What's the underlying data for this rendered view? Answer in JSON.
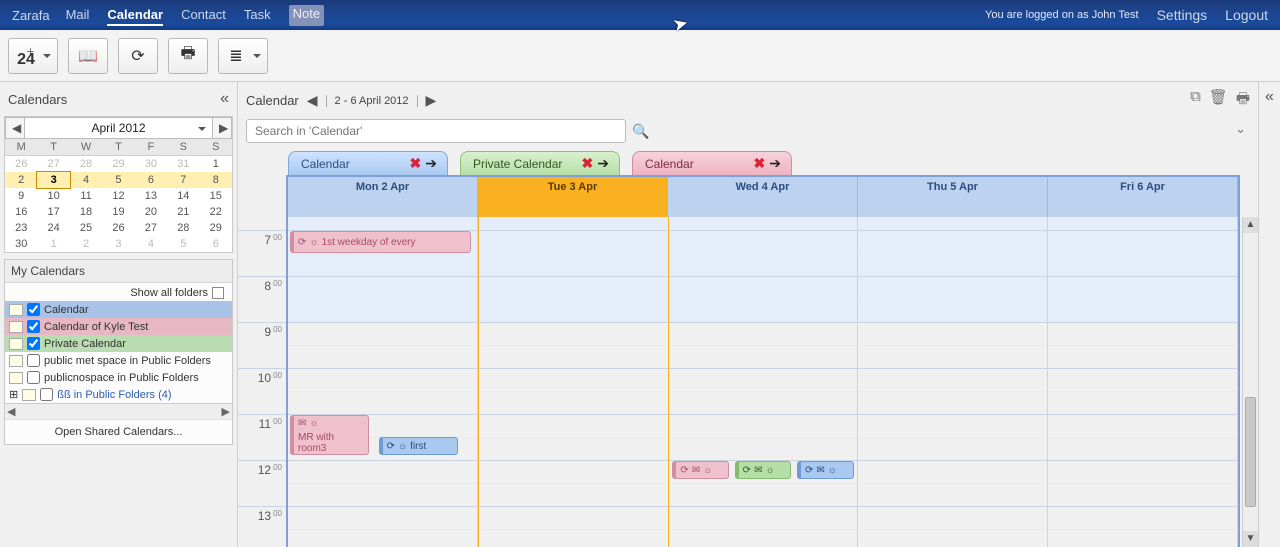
{
  "brand": "Zarafa",
  "nav": {
    "mail": "Mail",
    "calendar": "Calendar",
    "contact": "Contact",
    "task": "Task",
    "note": "Note"
  },
  "logged_on_prefix": "You are logged on as ",
  "logged_on_user": "John Test",
  "settings": "Settings",
  "logout": "Logout",
  "toolbar": {
    "new_day": "24",
    "addressbook": "📖",
    "refresh": "⟳",
    "print": "🖶",
    "view": "≣"
  },
  "side": {
    "calendars_label": "Calendars",
    "month_title": "April 2012",
    "dow": [
      "M",
      "T",
      "W",
      "T",
      "F",
      "S",
      "S"
    ],
    "weeks": [
      [
        "26",
        "27",
        "28",
        "29",
        "30",
        "31",
        "1"
      ],
      [
        "2",
        "3",
        "4",
        "5",
        "6",
        "7",
        "8"
      ],
      [
        "9",
        "10",
        "11",
        "12",
        "13",
        "14",
        "15"
      ],
      [
        "16",
        "17",
        "18",
        "19",
        "20",
        "21",
        "22"
      ],
      [
        "23",
        "24",
        "25",
        "26",
        "27",
        "28",
        "29"
      ],
      [
        "30",
        "1",
        "2",
        "3",
        "4",
        "5",
        "6"
      ]
    ],
    "my_calendars": "My Calendars",
    "show_all": "Show all folders",
    "items": [
      "Calendar",
      "Calendar of Kyle Test",
      "Private Calendar",
      "public met space in Public Folders",
      "publicnospace in Public Folders",
      "ßß in Public Folders  (4)"
    ],
    "open_shared": "Open Shared Calendars..."
  },
  "main": {
    "title": "Calendar",
    "range": "2 - 6 April 2012",
    "search_placeholder": "Search in 'Calendar'",
    "tabs": [
      "Calendar",
      "Private Calendar",
      "Calendar"
    ],
    "days": [
      "Mon 2 Apr",
      "Tue 3 Apr",
      "Wed 4 Apr",
      "Thu 5 Apr",
      "Fri 6 Apr"
    ],
    "hours": [
      "7",
      "8",
      "9",
      "10",
      "11",
      "12",
      "13"
    ],
    "min": "00"
  },
  "events": {
    "first_weekday": "1st weekday of every",
    "mr_with": "MR with room3",
    "first": "first"
  }
}
